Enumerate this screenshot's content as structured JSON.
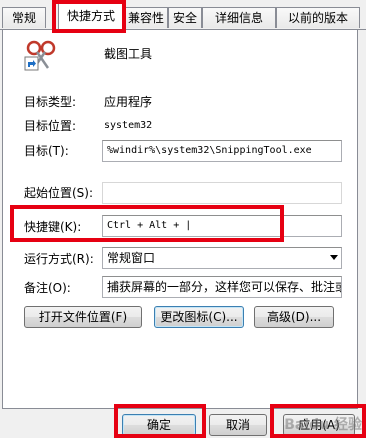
{
  "tabs": [
    {
      "label": "常规",
      "active": false
    },
    {
      "label": "快捷方式",
      "active": true
    },
    {
      "label": "兼容性",
      "active": false
    },
    {
      "label": "安全",
      "active": false
    },
    {
      "label": "详细信息",
      "active": false
    },
    {
      "label": "以前的版本",
      "active": false
    }
  ],
  "app": {
    "name": "截图工具",
    "icon": "scissors-shortcut-icon"
  },
  "props": {
    "target_type_label": "目标类型:",
    "target_type_value": "应用程序",
    "target_location_label": "目标位置:",
    "target_location_value": "system32",
    "target_label": "目标(T):",
    "target_value": "%windir%\\system32\\SnippingTool.exe",
    "start_in_label": "起始位置(S):",
    "start_in_value": "",
    "shortcut_key_label": "快捷键(K):",
    "shortcut_key_value": "Ctrl + Alt + |",
    "run_label": "运行方式(R):",
    "run_value": "常规窗口",
    "comment_label": "备注(O):",
    "comment_value": "捕获屏幕的一部分，这样您可以保存、批注或"
  },
  "buttons": {
    "open_location": "打开文件位置(F)",
    "change_icon": "更改图标(C)...",
    "advanced": "高级(D)...",
    "ok": "确定",
    "cancel": "取消",
    "apply": "应用(A)"
  },
  "watermark": "Baidu 经验"
}
